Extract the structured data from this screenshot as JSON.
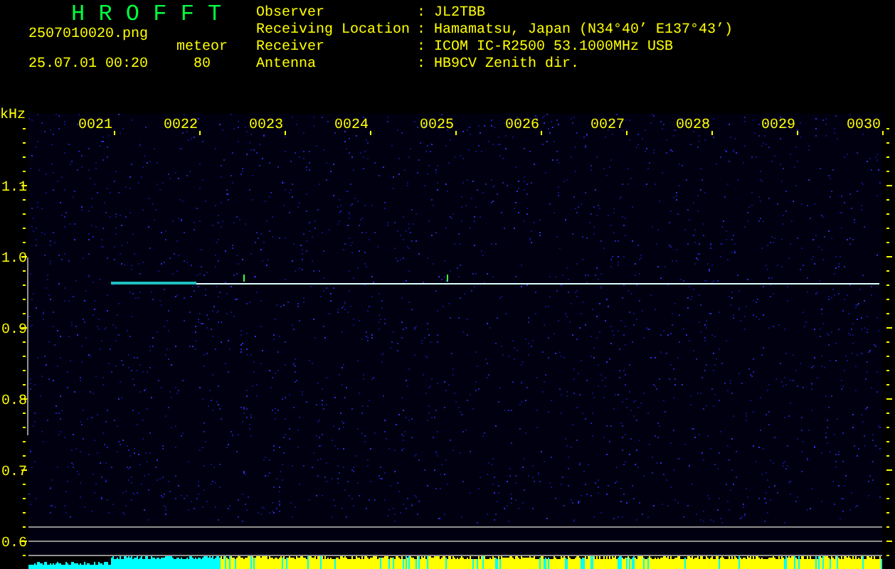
{
  "header": {
    "title": "H R O F F T",
    "file_name": "2507010020.png",
    "date_time": "25.07.01 00:20",
    "counter_label": "meteor",
    "counter_value": "80"
  },
  "station_info": [
    {
      "label": "Observer",
      "separator": ":",
      "value": "JL2TBB"
    },
    {
      "label": "Receiving Location",
      "separator": ":",
      "value": "Hamamatsu, Japan (N34°40’ E137°43’)"
    },
    {
      "label": "Receiver",
      "separator": ":",
      "value": "ICOM IC-R2500 53.1000MHz USB"
    },
    {
      "label": "Antenna",
      "separator": ":",
      "value": "HB9CV Zenith dir."
    }
  ],
  "spectrogram": {
    "y_unit": "kHz",
    "x_labels": [
      "0021",
      "0022",
      "0023",
      "0024",
      "0025",
      "0026",
      "0027",
      "0028",
      "0029",
      "0030"
    ],
    "y_labels": [
      "1.1",
      "1.0",
      "0.9",
      "0.8",
      "0.7",
      "0.6"
    ]
  }
}
